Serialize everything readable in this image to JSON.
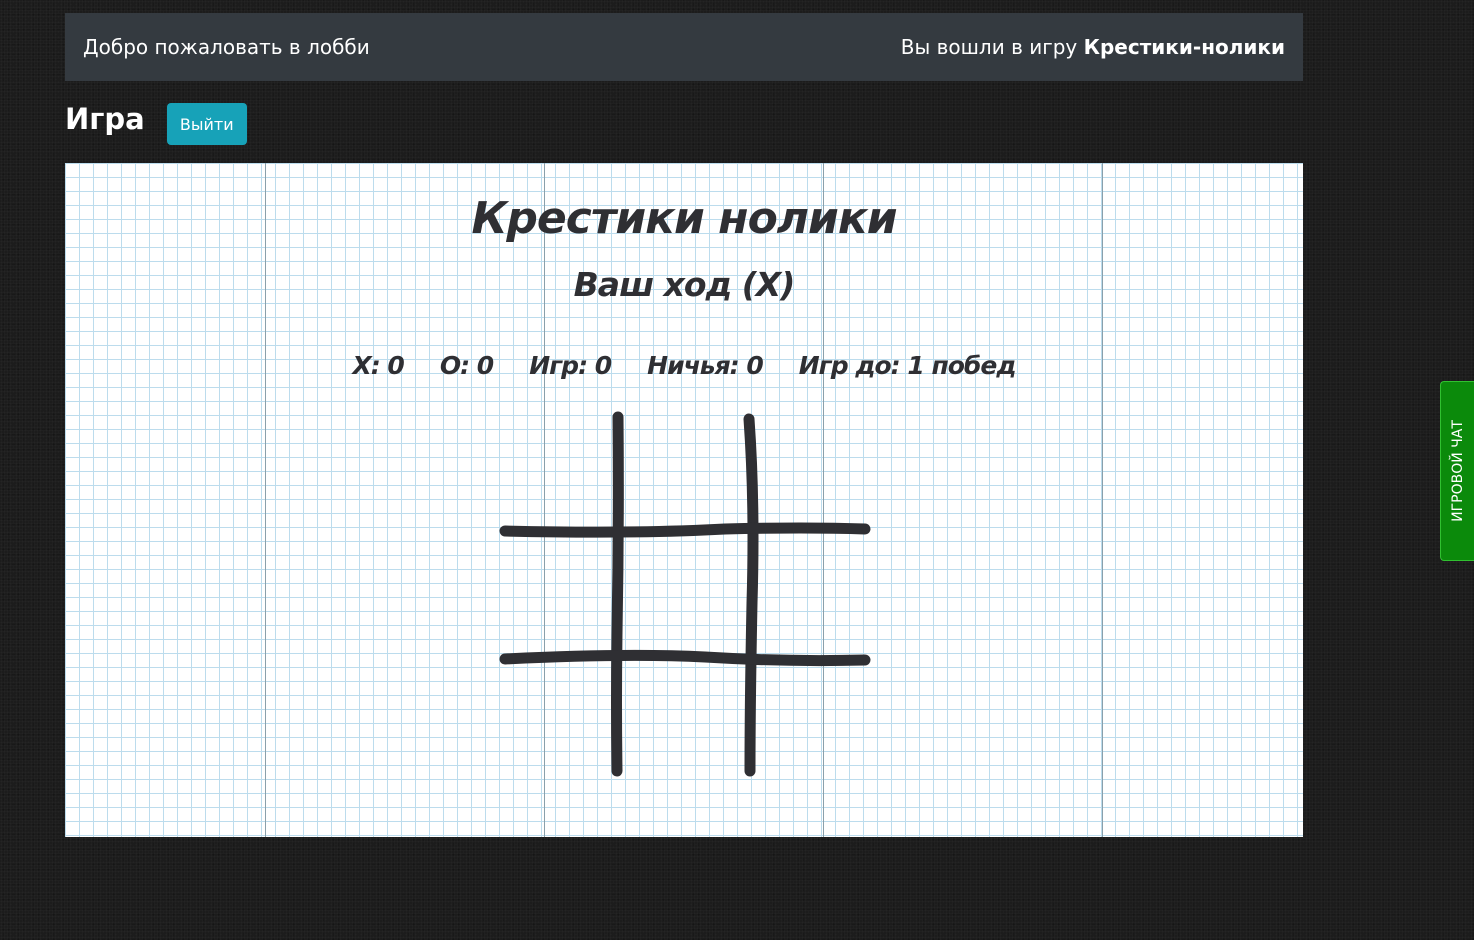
{
  "topbar": {
    "welcome": "Добро пожаловать в лобби",
    "joined_prefix": "Вы вошли в игру",
    "game_name": "Крестики-нолики"
  },
  "header": {
    "title": "Игра",
    "exit_label": "Выйти"
  },
  "game": {
    "title": "Крестики нолики",
    "turn": "Ваш ход (X)",
    "stats": {
      "x": "X: 0",
      "o": "O: 0",
      "games": "Игр: 0",
      "draws": "Ничья: 0",
      "games_to": "Игр до: 1 побед"
    },
    "cells": [
      "",
      "",
      "",
      "",
      "",
      "",
      "",
      "",
      ""
    ]
  },
  "chat_tab": {
    "label": "ИГРОВОЙ ЧАТ"
  },
  "colors": {
    "topbar": "#343a40",
    "button": "#17a2b8",
    "chat_tab": "#0b8a0b",
    "ink": "#2f2f33",
    "paper_grid": "#bcdced"
  }
}
